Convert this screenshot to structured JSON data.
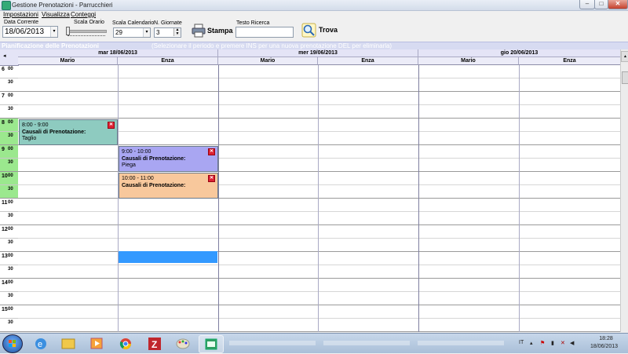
{
  "window": {
    "title": "Gestione Prenotazioni - Parrucchieri",
    "min_label": "–",
    "max_label": "□",
    "close_label": "✕"
  },
  "menu": {
    "items": [
      {
        "label": "Impostazioni"
      },
      {
        "label": "Visualizza"
      },
      {
        "label": "Conteggi"
      }
    ]
  },
  "toolbar": {
    "date_label": "Data Corrente",
    "date_value": "18/06/2013",
    "time_scale_label": "Scala Orario",
    "calendar_scale_label": "Scala Calendario",
    "calendar_scale_value": "29",
    "days_label": "N. Giornate",
    "days_value": "3",
    "print_label": "Stampa",
    "search_label": "Testo Ricerca",
    "search_value": "",
    "find_label": "Trova",
    "dropdown_glyph": "▾"
  },
  "planner": {
    "title": "Pianificazione delle Prenotazioni",
    "hint": "(Selezionare il periodo e premere INS per una nuova prenotazione DEL per eliminarla)",
    "days": [
      {
        "label": "mar 18/06/2013"
      },
      {
        "label": "mer 19/06/2013"
      },
      {
        "label": "gio 20/06/2013"
      }
    ],
    "resources": [
      "Mario",
      "Enza",
      "Mario",
      "Enza",
      "Mario",
      "Enza"
    ],
    "times": [
      {
        "hour": "6",
        "min": "00"
      },
      {
        "hour": "",
        "min": "30"
      },
      {
        "hour": "7",
        "min": "00"
      },
      {
        "hour": "",
        "min": "30"
      },
      {
        "hour": "8",
        "min": "00"
      },
      {
        "hour": "",
        "min": "30"
      },
      {
        "hour": "9",
        "min": "00"
      },
      {
        "hour": "",
        "min": "30"
      },
      {
        "hour": "10",
        "min": "00"
      },
      {
        "hour": "",
        "min": "30"
      },
      {
        "hour": "11",
        "min": "00"
      },
      {
        "hour": "",
        "min": "30"
      },
      {
        "hour": "12",
        "min": "00"
      },
      {
        "hour": "",
        "min": "30"
      },
      {
        "hour": "13",
        "min": "00"
      },
      {
        "hour": "",
        "min": "30"
      },
      {
        "hour": "14",
        "min": "00"
      },
      {
        "hour": "",
        "min": "30"
      },
      {
        "hour": "15",
        "min": "00"
      },
      {
        "hour": "",
        "min": "30"
      }
    ],
    "appointments": [
      {
        "time": "8:00 - 9:00",
        "caption": "Causali di Prenotazione:",
        "value": "Taglio",
        "color": "#8ecbc0"
      },
      {
        "time": "9:00 - 10:00",
        "caption": "Causali di Prenotazione:",
        "value": "Piega",
        "color": "#a9a6f2"
      },
      {
        "time": "10:00 - 11:00",
        "caption": "Causali di Prenotazione:",
        "value": "",
        "color": "#f8c89c"
      }
    ],
    "selection_color": "#3399ff",
    "close_glyph": "✕"
  },
  "taskbar": {
    "lang": "IT",
    "clock_time": "18:28",
    "clock_date": "18/06/2013"
  }
}
